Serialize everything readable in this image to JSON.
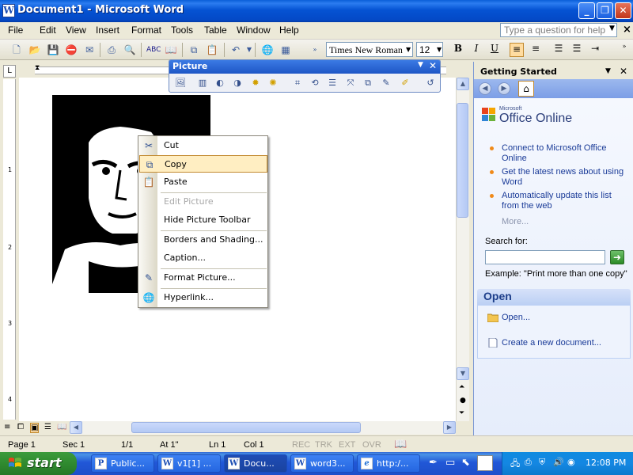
{
  "window": {
    "title": "Document1 - Microsoft Word",
    "app_icon": "W"
  },
  "menubar": {
    "items": [
      "File",
      "Edit",
      "View",
      "Insert",
      "Format",
      "Tools",
      "Table",
      "Window",
      "Help"
    ],
    "help_placeholder": "Type a question for help"
  },
  "formatting": {
    "font": "Times New Roman",
    "size": "12",
    "bold": "B",
    "italic": "I",
    "underline": "U"
  },
  "ruler": {
    "vertical_numbers": [
      "1",
      "2",
      "3",
      "4"
    ]
  },
  "picture_toolbar": {
    "title": "Picture"
  },
  "context_menu": {
    "items": [
      {
        "label": "Cut",
        "icon": "scissors-icon",
        "enabled": true
      },
      {
        "label": "Copy",
        "icon": "copy-icon",
        "enabled": true,
        "selected": true
      },
      {
        "label": "Paste",
        "icon": "paste-icon",
        "enabled": true
      },
      {
        "label": "Edit Picture",
        "enabled": false
      },
      {
        "label": "Hide Picture Toolbar",
        "enabled": true
      },
      {
        "label": "Borders and Shading...",
        "enabled": true
      },
      {
        "label": "Caption...",
        "enabled": true
      },
      {
        "label": "Format Picture...",
        "icon": "format-picture-icon",
        "enabled": true
      },
      {
        "label": "Hyperlink...",
        "icon": "hyperlink-icon",
        "enabled": true
      }
    ]
  },
  "task_pane": {
    "title": "Getting Started",
    "logo_small": "Microsoft",
    "logo": "Office Online",
    "links": [
      "Connect to Microsoft Office Online",
      "Get the latest news about using Word",
      "Automatically update this list from the web"
    ],
    "more": "More...",
    "search_label": "Search for:",
    "example": "Example:  \"Print more than one copy\"",
    "open_header": "Open",
    "open_link": "Open...",
    "create_link": "Create a new document..."
  },
  "status": {
    "page": "Page  1",
    "sec": "Sec  1",
    "pages": "1/1",
    "at": "At  1\"",
    "ln": "Ln  1",
    "col": "Col  1",
    "rec": "REC",
    "trk": "TRK",
    "ext": "EXT",
    "ovr": "OVR"
  },
  "taskbar": {
    "start": "start",
    "tasks": [
      {
        "label": "Public...",
        "icon": "P"
      },
      {
        "label": "v1[1] ...",
        "icon": "W"
      },
      {
        "label": "Docu...",
        "icon": "W",
        "active": true
      },
      {
        "label": "word3...",
        "icon": "W"
      },
      {
        "label": "http:/...",
        "icon": "e"
      }
    ],
    "clock": "12:08 PM"
  },
  "colors": {
    "titlebar": "#0553d3",
    "selection": "#ffeec2",
    "taskbar": "#245edb",
    "start": "#3c9b3c",
    "link": "#1a3b98"
  }
}
